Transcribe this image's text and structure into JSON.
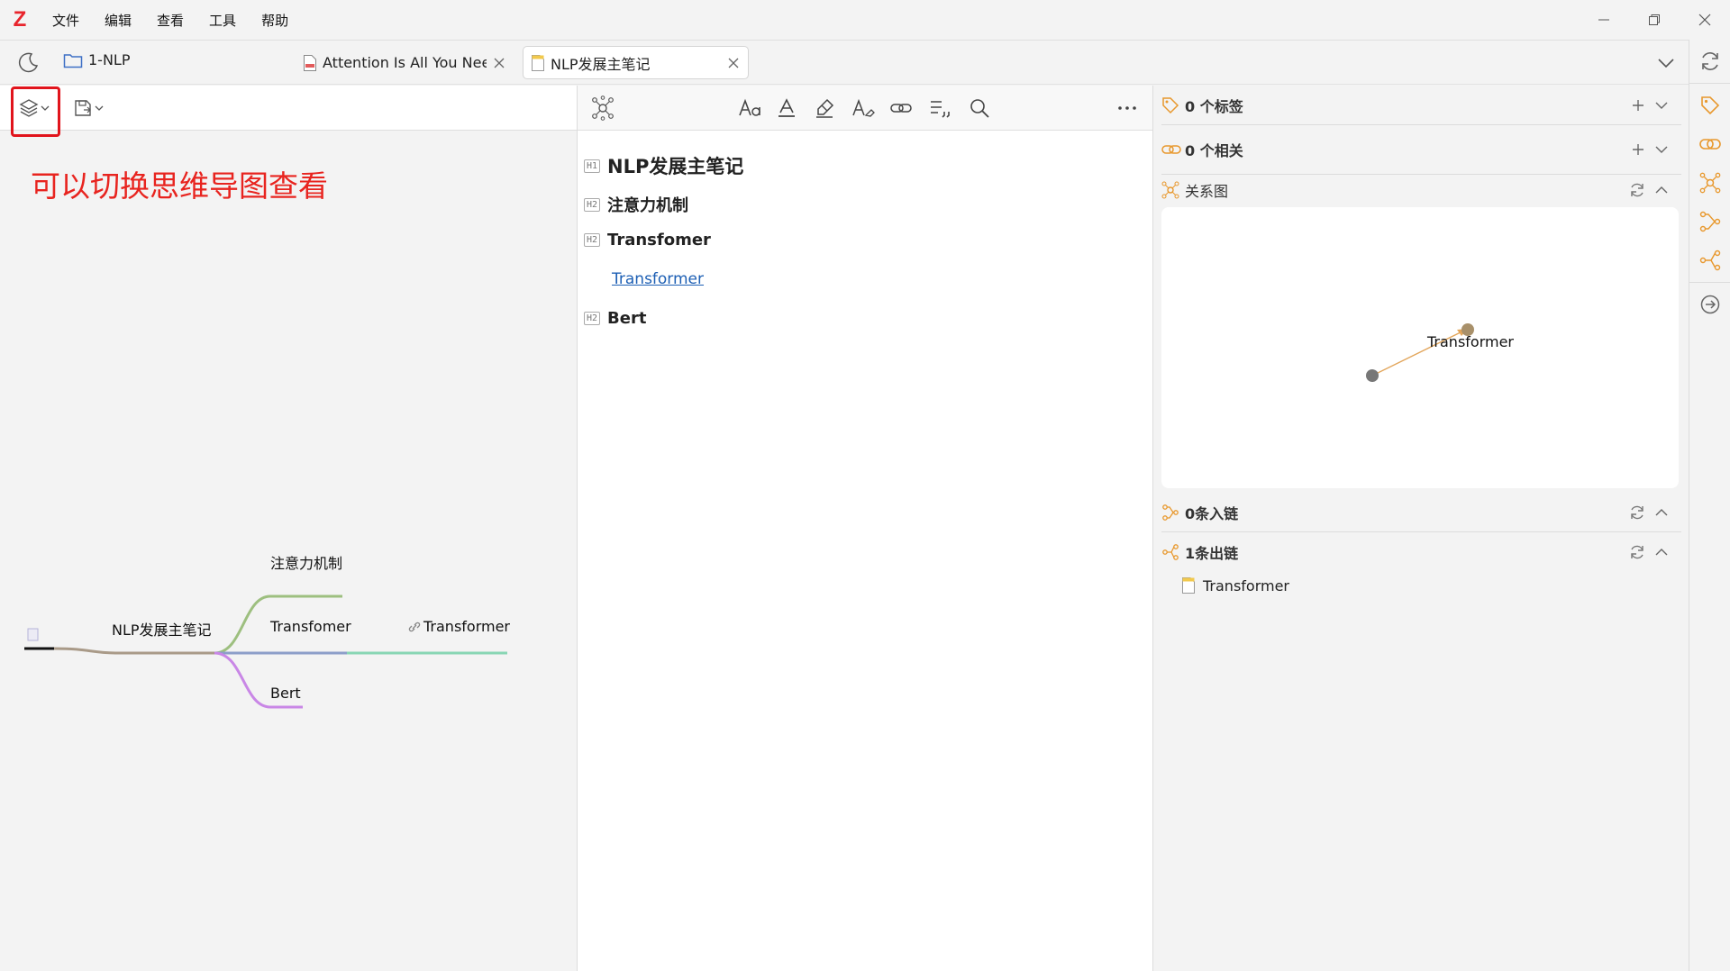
{
  "app": {
    "logo": "Z",
    "menu": [
      "文件",
      "编辑",
      "查看",
      "工具",
      "帮助"
    ]
  },
  "tabs": {
    "library": "1-NLP",
    "items": [
      {
        "title": "Attention Is All You Need",
        "type": "pdf",
        "active": false
      },
      {
        "title": "NLP发展主笔记",
        "type": "note",
        "active": true
      }
    ]
  },
  "left": {
    "annotation": "可以切换思维导图查看",
    "mindmap": {
      "root": "NLP发展主笔记",
      "branches": [
        "注意力机制",
        "Transfomer",
        "Bert"
      ],
      "link_child": "Transformer"
    }
  },
  "doc": {
    "headings": [
      {
        "level": "H1",
        "text": "NLP发展主笔记"
      },
      {
        "level": "H2",
        "text": "注意力机制"
      },
      {
        "level": "H2",
        "text": "Transfomer"
      },
      {
        "level": "H2",
        "text": "Bert"
      }
    ],
    "link": "Transformer"
  },
  "right": {
    "tags": "0 个标签",
    "related": "0 个相关",
    "graph": {
      "title": "关系图",
      "node_label": "Transformer"
    },
    "inlinks": "0条入链",
    "outlinks": "1条出链",
    "outlink_items": [
      "Transformer"
    ]
  },
  "colors": {
    "accent_red": "#e1141c",
    "link_blue": "#1d5fb4",
    "sidenav_orange": "#e8982d",
    "mm_green": "#9dbf7f",
    "mm_purple": "#c987e6",
    "mm_blue": "#8c9ec9",
    "mm_teal": "#88d6b4",
    "mm_root": "#a99a88"
  }
}
